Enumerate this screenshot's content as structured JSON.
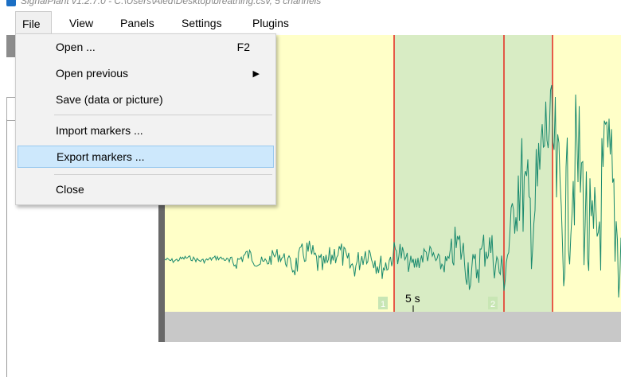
{
  "window": {
    "title": "SignalPlant v1.2.7.0 - C:\\Users\\Aled\\Desktop\\breathing.csv, 5 channels"
  },
  "menubar": {
    "items": [
      "File",
      "View",
      "Panels",
      "Settings",
      "Plugins"
    ]
  },
  "file_menu": {
    "open": {
      "label": "Open ...",
      "shortcut": "F2"
    },
    "open_previous": {
      "label": "Open previous",
      "submenu_arrow": "▶"
    },
    "save": {
      "label": "Save (data or picture)"
    },
    "import_markers": {
      "label": "Import markers ..."
    },
    "export_markers": {
      "label": "Export markers ..."
    },
    "close": {
      "label": "Close"
    }
  },
  "plot": {
    "background_color": "#ffffc8",
    "signal_color": "#1a8a6e",
    "marker_color": "#e6261f",
    "marker_region_color": "#d8ecc4",
    "markers": [
      {
        "label": "1",
        "start_s": 4.67,
        "end_s": 6.0
      },
      {
        "label": "2",
        "start_s": 6.0,
        "end_s": 6.55
      }
    ],
    "time_label": "5 s"
  }
}
